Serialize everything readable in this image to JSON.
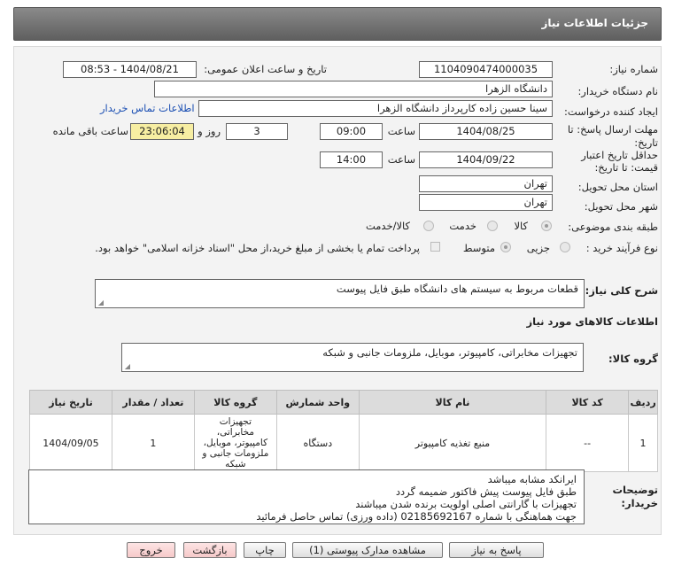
{
  "header": {
    "title": "جزئیات اطلاعات نیاز"
  },
  "form": {
    "need_number_label": "شماره نیاز:",
    "need_number": "1104090474000035",
    "announce_label": "تاریخ و ساعت اعلان عمومی:",
    "announce_value": "1404/08/21 - 08:53",
    "buyer_label": "نام دستگاه خریدار:",
    "buyer_value": "دانشگاه الزهرا",
    "creator_label": "ایجاد کننده درخواست:",
    "creator_value": "سینا حسین زاده کارپرداز دانشگاه الزهرا",
    "contact_link": "اطلاعات تماس خریدار",
    "deadline_label_1": "مهلت ارسال پاسخ: تا",
    "deadline_label_2": "تاریخ:",
    "deadline_date": "1404/08/25",
    "time_label": "ساعت",
    "deadline_time": "09:00",
    "days_value": "3",
    "days_label": "روز و",
    "remaining_value": "23:06:04",
    "remaining_label": "ساعت باقی مانده",
    "validity_label_1": "حداقل تاریخ اعتبار",
    "validity_label_2": "قیمت: تا تاریخ:",
    "validity_date": "1404/09/22",
    "validity_time_label": "ساعت",
    "validity_time": "14:00",
    "province_label": "استان محل تحویل:",
    "province_value": "تهران",
    "city_label": "شهر محل تحویل:",
    "city_value": "تهران",
    "category_label": "طبقه بندی موضوعی:",
    "category_options": [
      "کالا",
      "خدمت",
      "کالا/خدمت"
    ],
    "purchase_label": "نوع فرآیند خرید :",
    "purchase_options": [
      "جزیی",
      "متوسط"
    ],
    "payment_text": "پرداخت تمام یا بخشی از مبلغ خرید،از محل \"اسناد خزانه اسلامی\" خواهد بود.",
    "description_label": "شرح کلی نیاز:",
    "description_value": "قطعات مربوط به سیستم های دانشگاه طبق فایل پیوست",
    "goods_section": "اطلاعات کالاهای مورد نیاز",
    "goods_group_label": "گروه کالا:",
    "goods_group_value": "تجهیزات مخابراتی، کامپیوتر، موبایل، ملزومات جانبی و شبکه"
  },
  "table": {
    "headers": [
      "ردیف",
      "کد کالا",
      "نام کالا",
      "واحد شمارش",
      "گروه کالا",
      "تعداد / مقدار",
      "تاریخ نیاز"
    ],
    "rows": [
      [
        "1",
        "--",
        "منبع تغذیه کامپیوتر",
        "دستگاه",
        "تجهیزات مخابراتی، کامپیوتر، موبایل، ملزومات جانبی و شبکه",
        "1",
        "1404/09/05"
      ]
    ]
  },
  "notes": {
    "label_1": "توضیحات",
    "label_2": "خریدار:",
    "lines": [
      "ایرانکد مشابه میباشد",
      "طبق فایل پیوست پیش فاکتور ضمیمه گردد",
      "تجهیزات با گارانتی اصلی اولویت برنده شدن میباشند",
      "جهت هماهنگی با شماره 02185692167 (داده ورزی) تماس حاصل فرمائید"
    ]
  },
  "buttons": {
    "reply": "پاسخ به نیاز",
    "docs": "مشاهده مدارک پیوستی (1)",
    "print": "چاپ",
    "back": "بازگشت",
    "exit": "خروج"
  },
  "colors": {
    "header_bg": "#6f6f6f",
    "link": "#1b4fb3",
    "remaining_bg": "#f7eea2"
  }
}
